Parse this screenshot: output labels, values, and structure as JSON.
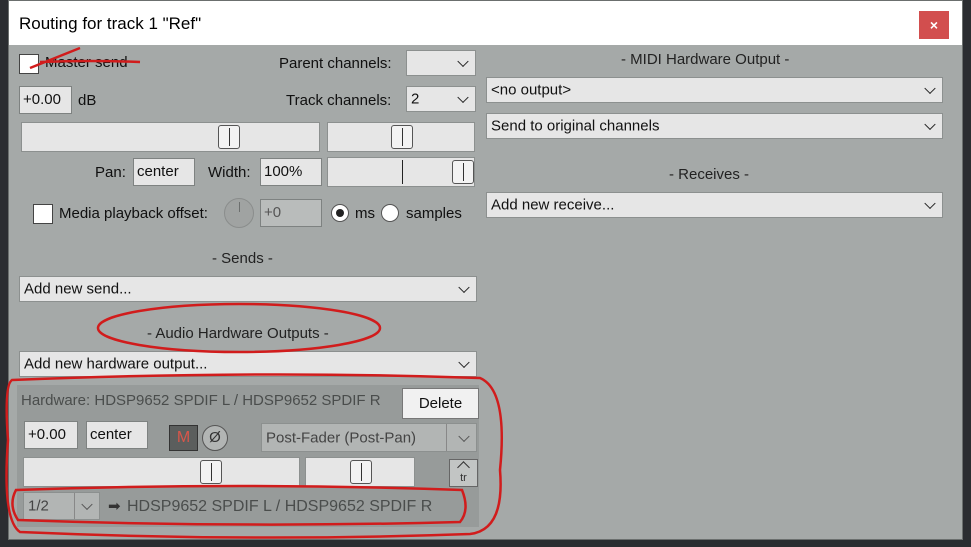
{
  "window": {
    "title": "Routing for track 1 \"Ref\"",
    "close_label": "×"
  },
  "left": {
    "master_send": {
      "label": "Master send",
      "checked": false
    },
    "parent_channels": {
      "label": "Parent channels:",
      "value": ""
    },
    "volume": {
      "value": "+0.00",
      "unit": "dB"
    },
    "track_channels": {
      "label": "Track channels:",
      "value": "2"
    },
    "pan": {
      "label": "Pan:",
      "value": "center"
    },
    "width": {
      "label": "Width:",
      "value": "100%"
    },
    "media_offset": {
      "label": "Media playback offset:",
      "value": "+0",
      "checked": false
    },
    "unit_options": [
      {
        "label": "ms",
        "selected": true
      },
      {
        "label": "samples",
        "selected": false
      }
    ],
    "sends_header": "- Sends -",
    "add_send": "Add new send...",
    "hw_header": "- Audio Hardware Outputs -",
    "add_hw": "Add new hardware output...",
    "hw_output": {
      "title": "Hardware: HDSP9652 SPDIF L / HDSP9652 SPDIF R",
      "delete_label": "Delete",
      "volume": "+0.00",
      "pan": "center",
      "mute_label": "M",
      "phase_label": "Ø",
      "mode": "Post-Fader (Post-Pan)",
      "env_label": "tr",
      "channel": "1/2",
      "arrow": "➡",
      "destination": "HDSP9652 SPDIF L / HDSP9652 SPDIF R"
    }
  },
  "right": {
    "midi_header": "- MIDI Hardware Output -",
    "midi_output": "<no output>",
    "midi_channels": "Send to original channels",
    "receives_header": "- Receives -",
    "add_receive": "Add new receive..."
  },
  "colors": {
    "window_bg": "#a5a9a8",
    "close_button": "#d24e4e",
    "annotation": "#d11c1c"
  }
}
